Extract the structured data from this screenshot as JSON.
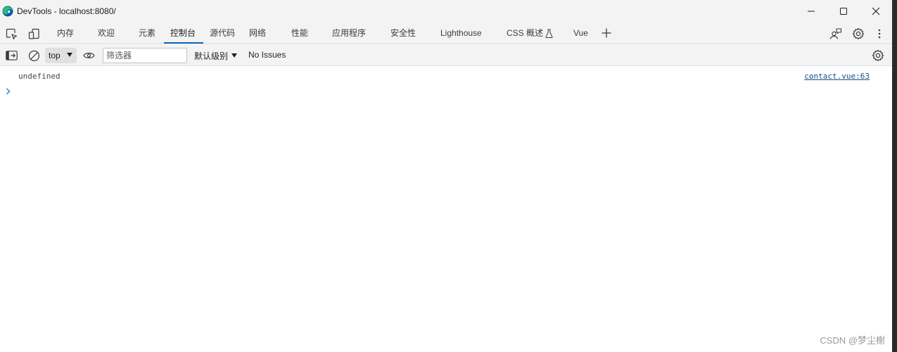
{
  "window": {
    "title": "DevTools - localhost:8080/",
    "controls": [
      "minimize-icon",
      "maximize-icon",
      "close-icon"
    ]
  },
  "tabs": {
    "left_icons": [
      "inspect-element-icon",
      "device-emulation-icon"
    ],
    "items": [
      {
        "label": "内存"
      },
      {
        "label": "欢迎"
      },
      {
        "label": "元素"
      },
      {
        "label": "控制台",
        "active": true
      },
      {
        "label": "源代码"
      },
      {
        "label": "网络"
      },
      {
        "label": "性能"
      },
      {
        "label": "应用程序"
      },
      {
        "label": "安全性"
      },
      {
        "label": "Lighthouse"
      },
      {
        "label": "CSS 概述",
        "icon": "flask-icon"
      },
      {
        "label": "Vue"
      }
    ],
    "add_tab_icon": "plus-icon",
    "right_icons": [
      "feedback-icon",
      "settings-icon",
      "more-options-icon"
    ]
  },
  "toolbar": {
    "sidebar_toggle_icon": "sidebar-toggle-icon",
    "clear_icon": "clear-console-icon",
    "context": "top",
    "live_expression_icon": "eye-icon",
    "filter_placeholder": "筛选器",
    "filter_value": "",
    "levels_label": "默认级别",
    "issues_label": "No Issues",
    "settings_icon": "console-settings-icon"
  },
  "console": {
    "messages": [
      {
        "text": "undefined",
        "source": "contact.vue:63"
      }
    ],
    "prompt_icon": "chevron-right-icon"
  },
  "watermark": "CSDN @梦尘榭",
  "colors": {
    "accent": "#0f6cbd",
    "chrome_bg": "#f3f3f3",
    "link": "#1a4c8c",
    "edge_icon_blue": "#0c59a4",
    "edge_icon_green": "#2ebf72"
  }
}
